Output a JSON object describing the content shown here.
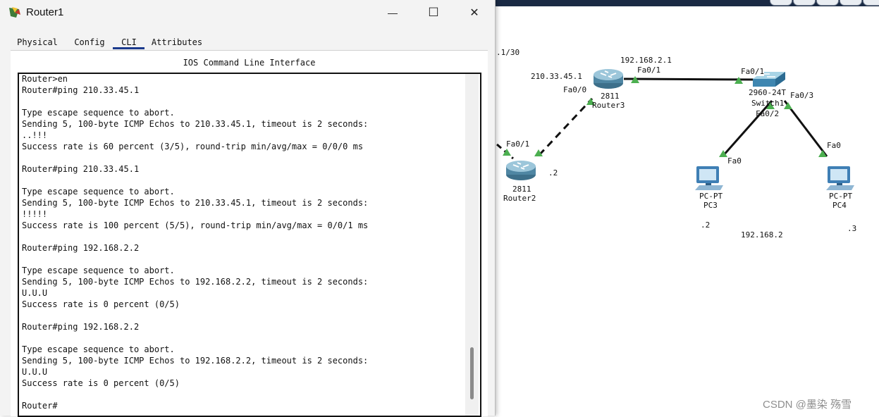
{
  "window": {
    "title": "Router1",
    "controls": {
      "minimize": "—",
      "maximize": "☐",
      "close": "✕"
    }
  },
  "tabs": [
    {
      "label": "Physical",
      "active": false
    },
    {
      "label": "Config",
      "active": false
    },
    {
      "label": "CLI",
      "active": true
    },
    {
      "label": "Attributes",
      "active": false
    }
  ],
  "panel_title": "IOS Command Line Interface",
  "terminal": {
    "lines": [
      "Router>en",
      "Router#ping 210.33.45.1",
      "",
      "Type escape sequence to abort.",
      "Sending 5, 100-byte ICMP Echos to 210.33.45.1, timeout is 2 seconds:",
      "..!!!",
      "Success rate is 60 percent (3/5), round-trip min/avg/max = 0/0/0 ms",
      "",
      "Router#ping 210.33.45.1",
      "",
      "Type escape sequence to abort.",
      "Sending 5, 100-byte ICMP Echos to 210.33.45.1, timeout is 2 seconds:",
      "!!!!!",
      "Success rate is 100 percent (5/5), round-trip min/avg/max = 0/0/1 ms",
      "",
      "Router#ping 192.168.2.2",
      "",
      "Type escape sequence to abort.",
      "Sending 5, 100-byte ICMP Echos to 192.168.2.2, timeout is 2 seconds:",
      "U.U.U",
      "Success rate is 0 percent (0/5)",
      "",
      "Router#ping 192.168.2.2",
      "",
      "Type escape sequence to abort.",
      "Sending 5, 100-byte ICMP Echos to 192.168.2.2, timeout is 2 seconds:",
      "U.U.U",
      "Success rate is 0 percent (0/5)",
      "",
      "Router#"
    ]
  },
  "topology": {
    "labels": {
      "net_partial": ".1/30",
      "r3_ip_left": "210.33.45.1",
      "r3_fa00": "Fa0/0",
      "r3_ip_right": "192.168.2.1",
      "r3_fa01": "Fa0/1",
      "r3_model": "2811",
      "r3_name": "Router3",
      "r2_fa01": "Fa0/1",
      "r2_dot2": ".2",
      "r2_model": "2811",
      "r2_name": "Router2",
      "sw_fa01": "Fa0/1",
      "sw_model": "2960-24T",
      "sw_name": "Switch1",
      "sw_fa03": "Fa0/3",
      "sw_fa02": "Fa0/2",
      "pc3_fa0": "Fa0",
      "pc3_type": "PC-PT",
      "pc3_name": "PC3",
      "pc4_fa0": "Fa0",
      "pc4_type": "PC-PT",
      "pc4_name": "PC4",
      "pc3_dot2": ".2",
      "pc4_dot3": ".3",
      "lan_net": "192.168.2"
    }
  },
  "watermark": "CSDN @墨染 殇雪",
  "colors": {
    "link_up": "#4caf50",
    "cable": "#111111",
    "tab_underline": "#1b3a8c"
  },
  "icons": [
    "router-icon",
    "switch-icon",
    "pc-icon",
    "minimize-icon",
    "maximize-icon",
    "close-icon",
    "app-icon"
  ]
}
